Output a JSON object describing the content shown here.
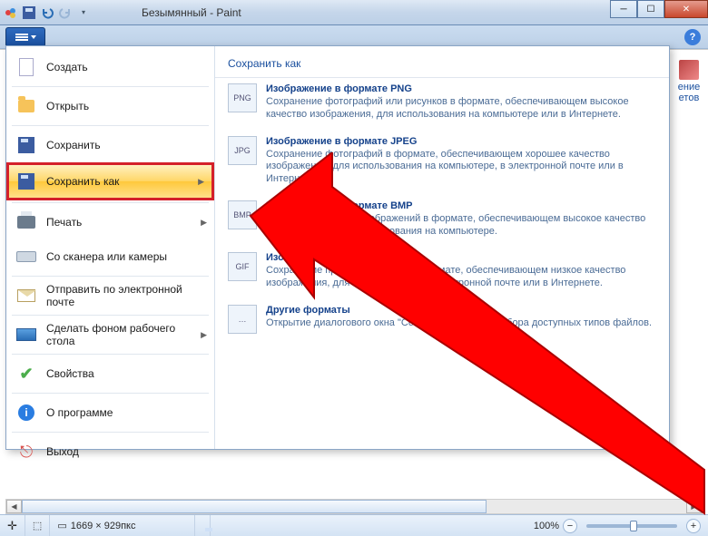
{
  "window": {
    "title": "Безымянный - Paint"
  },
  "help_label": "?",
  "ribbon_hint": {
    "line1": "ение",
    "line2": "етов"
  },
  "file_menu": {
    "items": [
      {
        "label": "Создать"
      },
      {
        "label": "Открыть"
      },
      {
        "label": "Сохранить"
      },
      {
        "label": "Сохранить как",
        "selected": true,
        "has_sub": true
      },
      {
        "label": "Печать",
        "has_sub": true
      },
      {
        "label": "Со сканера или камеры"
      },
      {
        "label": "Отправить по электронной почте"
      },
      {
        "label": "Сделать фоном рабочего стола",
        "has_sub": true
      },
      {
        "label": "Свойства"
      },
      {
        "label": "О программе"
      },
      {
        "label": "Выход"
      }
    ]
  },
  "submenu": {
    "title": "Сохранить как",
    "items": [
      {
        "title": "Изображение в формате PNG",
        "desc": "Сохранение фотографий или рисунков в формате, обеспечивающем высокое качество изображения, для использования на компьютере или в Интернете."
      },
      {
        "title": "Изображение в формате JPEG",
        "desc": "Сохранение фотографий в формате, обеспечивающем хорошее качество изображения, для использования на компьютере, в электронной почте или в Интернете."
      },
      {
        "title": "Изображение в формате BMP",
        "desc": "Сохранение любых изображений в формате, обеспечивающем высокое качество изображения, для использования на компьютере."
      },
      {
        "title": "Изображение в формате GIF",
        "desc": "Сохранение простых рисунков в формате, обеспечивающем низкое качество изображения, для использования в электронной почте или в Интернете."
      },
      {
        "title": "Другие форматы",
        "desc": "Открытие диалогового окна \"Сохранить как\" для выбора доступных типов файлов."
      }
    ]
  },
  "statusbar": {
    "coords_icon": "+",
    "size_label": "1669 × 929пкс",
    "zoom_label": "100%"
  }
}
